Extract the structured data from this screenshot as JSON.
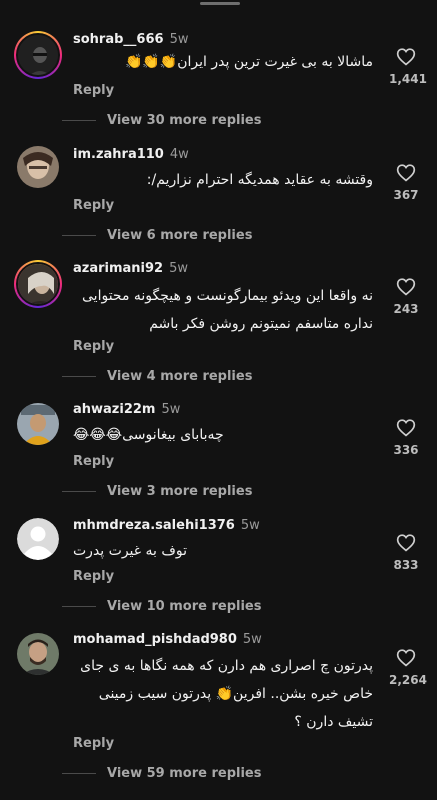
{
  "comments": [
    {
      "username": "sohrab__666",
      "time": "5w",
      "text": "ماشالا به بی غیرت ترین پدر ایران👏👏👏",
      "reply_label": "Reply",
      "likes": "1,441",
      "view_more": "View 30 more replies",
      "avatar_style": "story-ring"
    },
    {
      "username": "im.zahra110",
      "time": "4w",
      "text": "وقتشه به عقاید همدیگه احترام نزاریم/:",
      "reply_label": "Reply",
      "likes": "367",
      "view_more": "View 6 more replies",
      "avatar_style": "photo"
    },
    {
      "username": "azarimani92",
      "time": "5w",
      "text": "نه واقعا این ویدئو بیمارگونست و هیچگونه محتوایی نداره متاسفم نمیتونم روشن فکر باشم",
      "reply_label": "Reply",
      "likes": "243",
      "view_more": "View 4 more replies",
      "avatar_style": "story-ring"
    },
    {
      "username": "ahwazi22m",
      "time": "5w",
      "text": "چه‌بابای بیغانوسی😂😂😂",
      "reply_label": "Reply",
      "likes": "336",
      "view_more": "View 3 more replies",
      "avatar_style": "photo"
    },
    {
      "username": "mhmdreza.salehi1376",
      "time": "5w",
      "text": "توف به غیرت پدرت",
      "reply_label": "Reply",
      "likes": "833",
      "view_more": "View 10 more replies",
      "avatar_style": "default"
    },
    {
      "username": "mohamad_pishdad980",
      "time": "5w",
      "text": "پدرتون چ اصراری هم دارن که همه نگاها به ی جای خاص خیره بشن.. افرین👏 پدرتون سیب زمینی تشیف دارن ؟",
      "reply_label": "Reply",
      "likes": "2,264",
      "view_more": "View 59 more replies",
      "avatar_style": "photo"
    }
  ],
  "colors": {
    "background": "#121212",
    "primary_text": "#f5f5f5",
    "secondary_text": "#a8a8a8",
    "story_ring": "#ee2a7b"
  },
  "icons": {
    "like": "heart-outline-icon",
    "handle": "drag-handle"
  }
}
